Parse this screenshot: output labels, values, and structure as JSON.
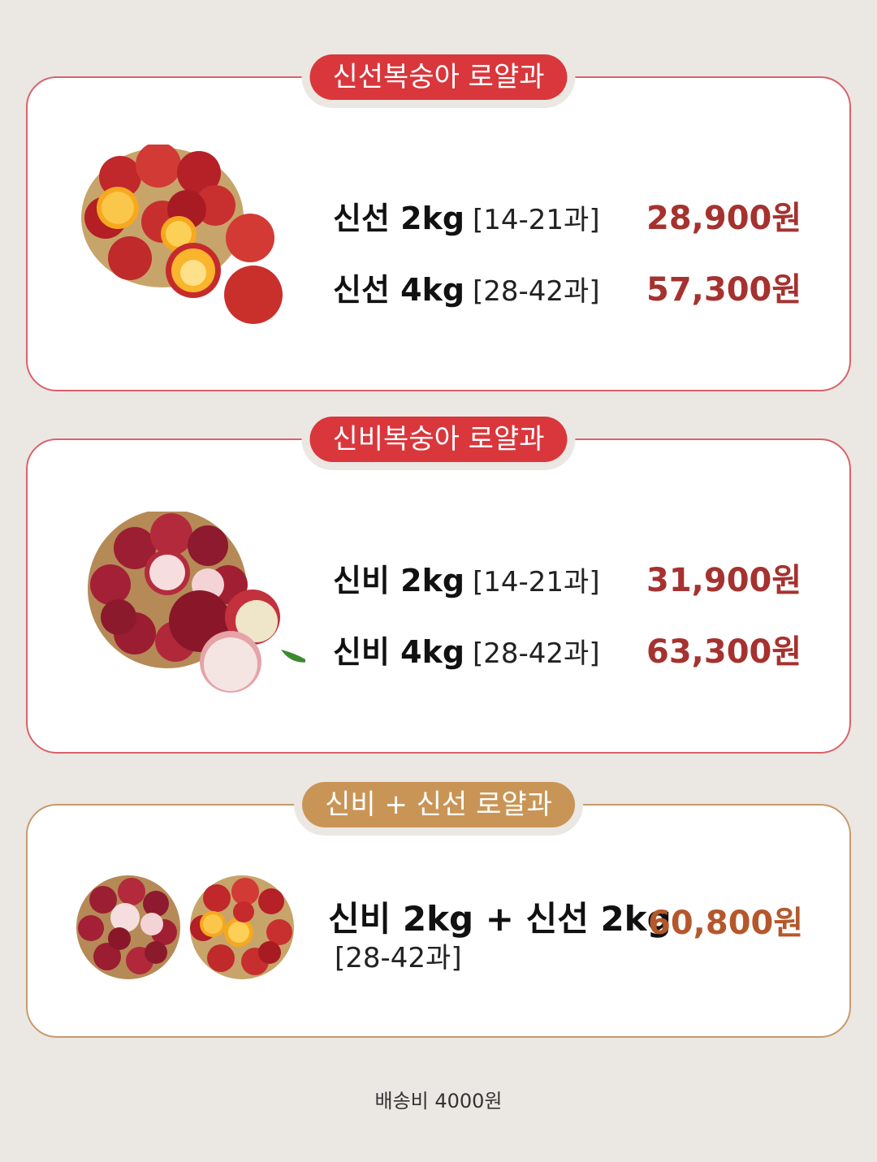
{
  "cards": [
    {
      "title": "신선복숭아 로얄과",
      "rows": [
        {
          "name": "신선 2kg",
          "count": "[14-21과]",
          "price": "28,900원"
        },
        {
          "name": "신선 4kg",
          "count": "[28-42과]",
          "price": "57,300원"
        }
      ]
    },
    {
      "title": "신비복숭아 로얄과",
      "rows": [
        {
          "name": "신비 2kg",
          "count": "[14-21과]",
          "price": "31,900원"
        },
        {
          "name": "신비 4kg",
          "count": "[28-42과]",
          "price": "63,300원"
        }
      ]
    },
    {
      "title": "신비 + 신선 로얄과",
      "combo": {
        "name": "신비 2kg + 신선 2kg",
        "count": "[28-42과]",
        "price": "60,800원"
      }
    }
  ],
  "footer": "배송비 4000원",
  "colors": {
    "accent_red": "#d9373c",
    "accent_gold": "#c99556",
    "price_red": "#a5322f",
    "price_gold": "#b4582c"
  },
  "icons": [
    "peach-basket-sinseon-image",
    "peach-basket-sinbi-image"
  ]
}
